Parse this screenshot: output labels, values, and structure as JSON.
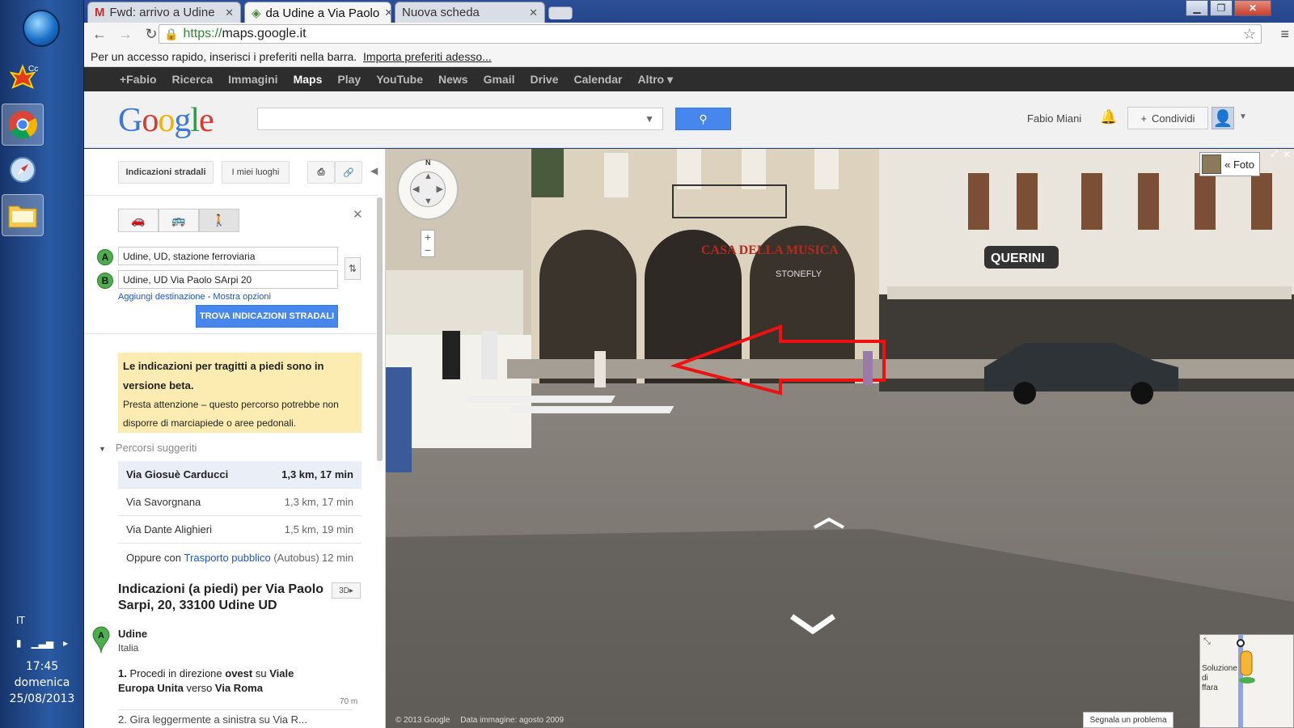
{
  "taskbar": {
    "language": "IT",
    "time": "17:45",
    "day": "domenica",
    "date": "25/08/2013",
    "icons": [
      "windows-orb-icon",
      "app-cc-icon",
      "chrome-icon",
      "safari-icon",
      "folder-icon"
    ]
  },
  "browser": {
    "tabs": [
      {
        "label": "Fwd: arrivo a Udine",
        "icon": "gmail-icon"
      },
      {
        "label": "da Udine a Via Paolo",
        "icon": "maps-icon"
      },
      {
        "label": "Nuova scheda",
        "icon": ""
      }
    ],
    "url_scheme": "https://",
    "url_host": "maps.google.it",
    "bookmarks_text": "Per un accesso rapido, inserisci i preferiti nella barra.",
    "bookmarks_link": "Importa preferiti adesso..."
  },
  "gbar": [
    "+Fabio",
    "Ricerca",
    "Immagini",
    "Maps",
    "Play",
    "YouTube",
    "News",
    "Gmail",
    "Drive",
    "Calendar",
    "Altro ▾"
  ],
  "header": {
    "logo": "Google",
    "user": "Fabio Miani",
    "share": "Condividi"
  },
  "panel": {
    "directions_btn": "Indicazioni stradali",
    "places_btn": "I miei luoghi",
    "start": "Udine, UD, stazione ferroviaria",
    "end": "Udine, UD Via Paolo SArpi 20",
    "add_dest": "Aggiungi destinazione",
    "sep": " - ",
    "show_opts": "Mostra opzioni",
    "find_btn": "TROVA INDICAZIONI STRADALI",
    "warn_title": "Le indicazioni per tragitti a piedi sono in versione beta.",
    "warn_body": "Presta attenzione – questo percorso potrebbe non disporre di marciapiede o aree pedonali.",
    "suggested": "Percorsi suggeriti",
    "routes": [
      {
        "name": "Via Giosuè Carducci",
        "value": "1,3 km, 17 min"
      },
      {
        "name": "Via Savorgnana",
        "value": "1,3 km, 17 min"
      },
      {
        "name": "Via Dante Alighieri",
        "value": "1,5 km, 19 min"
      }
    ],
    "transit_pre": "Oppure con ",
    "transit_link": "Trasporto pubblico",
    "transit_mode": " (Autobus)",
    "transit_time": "12 min",
    "dir_title": "Indicazioni (a piedi) per Via Paolo Sarpi, 20, 33100 Udine UD",
    "btn_3d": "3D",
    "origin_city": "Udine",
    "origin_country": "Italia",
    "step_num": "1.",
    "step_a": " Procedi in direzione ",
    "step_b": "ovest",
    "step_c": " su ",
    "step_d": "Viale Europa Unita",
    "step_e": " verso ",
    "step_f": "Via Roma",
    "step_dist": "70 m",
    "step2": "2. Gira leggermente a sinistra su Via R..."
  },
  "streetview": {
    "foto_btn": "« Foto",
    "shop1": "CASA DELLA MUSICA",
    "shop2": "STONEFLY",
    "shop3": "QUERINI",
    "watermark": "© 2013 Google",
    "date_label": "Data immagine: agosto 2009",
    "report": "Segnala un problema",
    "minimap_text": "Soluzione\ndi\nffara"
  }
}
